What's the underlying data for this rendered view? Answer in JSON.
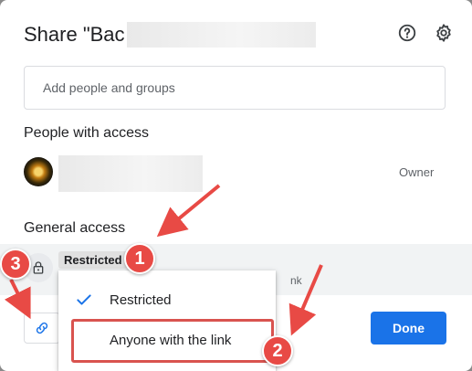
{
  "dialog": {
    "title": "Share \"Bac",
    "icons": {
      "help": "help-circle-icon",
      "settings": "gear-icon"
    }
  },
  "add_people": {
    "placeholder": "Add people and groups"
  },
  "people_with_access": {
    "title": "People with access",
    "owner_role": "Owner"
  },
  "general_access": {
    "title": "General access",
    "current": "Restricted",
    "description_fragment": "nk"
  },
  "dropdown": {
    "options": [
      "Restricted",
      "Anyone with the link"
    ],
    "selected": "Restricted"
  },
  "footer": {
    "done_label": "Done"
  },
  "annotations": {
    "badge_1": "1",
    "badge_2": "2",
    "badge_3": "3",
    "color": "#e84a45"
  },
  "colors": {
    "primary_button": "#1a73e8",
    "general_row_bg": "#f1f3f4"
  }
}
